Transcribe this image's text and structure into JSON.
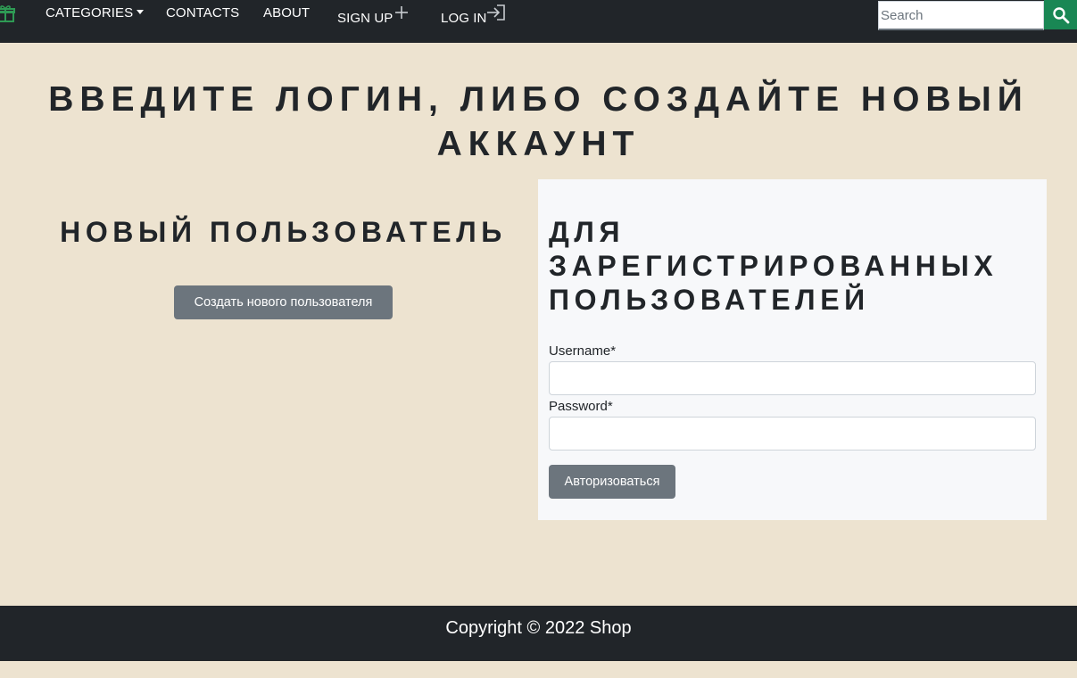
{
  "nav": {
    "categories": "CATEGORIES",
    "contacts": "CONTACTS",
    "about": "ABOUT",
    "signup": "SIGN UP",
    "login": "LOG IN",
    "search_placeholder": "Search",
    "icons": {
      "brand": "gift-icon",
      "categories": "caret-down-icon",
      "signup": "plus-icon",
      "login": "login-arrow-icon",
      "search": "search-icon"
    }
  },
  "main": {
    "title": "ВВЕДИТЕ ЛОГИН, ЛИБО СОЗДАЙТЕ НОВЫЙ АККАУНТ",
    "new_user": {
      "heading": "НОВЫЙ ПОЛЬЗОВАТЕЛЬ",
      "button": "Создать нового пользователя"
    },
    "registered": {
      "heading": "ДЛЯ ЗАРЕГИСТРИРОВАННЫХ ПОЛЬЗОВАТЕЛЕЙ",
      "username_label": "Username*",
      "username_value": "",
      "password_label": "Password*",
      "password_value": "",
      "submit": "Авторизоваться"
    }
  },
  "footer": {
    "copyright": "Copyright © 2022 Shop"
  },
  "colors": {
    "page_bg": "#ede3d0",
    "navbar_bg": "#212529",
    "panel_bg": "#f7f8fa",
    "button_secondary": "#6c757d",
    "search_button": "#198754",
    "brand_icon": "#2e9a54"
  }
}
